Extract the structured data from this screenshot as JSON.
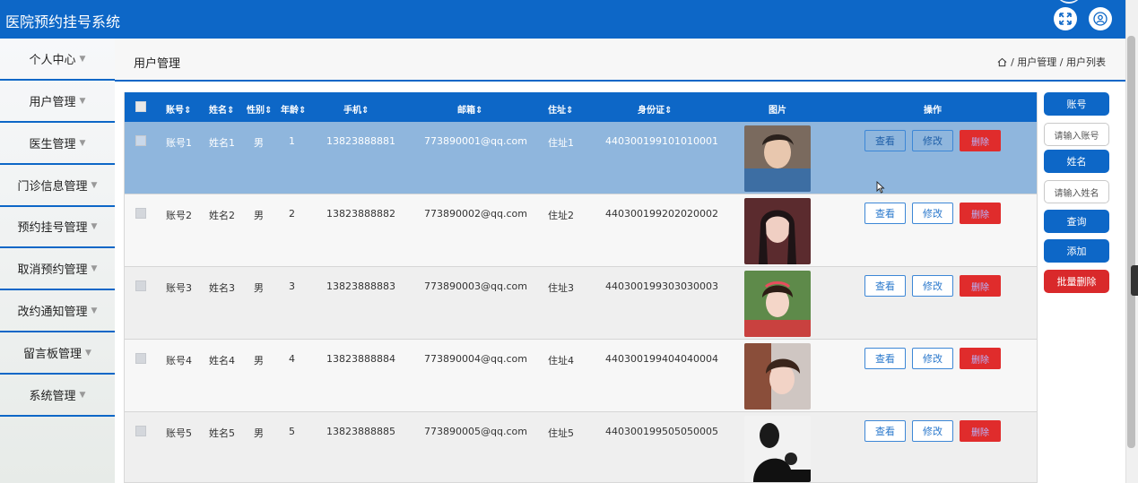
{
  "app": {
    "title": "医院预约挂号系统"
  },
  "topbar": {
    "icons": [
      "fullscreen-icon",
      "user-icon"
    ]
  },
  "sidebar": {
    "items": [
      {
        "label": "个人中心"
      },
      {
        "label": "用户管理"
      },
      {
        "label": "医生管理"
      },
      {
        "label": "门诊信息管理"
      },
      {
        "label": "预约挂号管理"
      },
      {
        "label": "取消预约管理"
      },
      {
        "label": "改约通知管理"
      },
      {
        "label": "留言板管理"
      },
      {
        "label": "系统管理"
      }
    ]
  },
  "header": {
    "page_title": "用户管理",
    "breadcrumb": "/ 用户管理 / 用户列表"
  },
  "table": {
    "columns": [
      "账号",
      "姓名",
      "性别",
      "年龄",
      "手机",
      "邮箱",
      "住址",
      "身份证",
      "图片",
      "操作"
    ],
    "rows": [
      {
        "account": "账号1",
        "name": "姓名1",
        "gender": "男",
        "age": "1",
        "phone": "13823888881",
        "email": "773890001@qq.com",
        "address": "住址1",
        "idcard": "440300199101010001"
      },
      {
        "account": "账号2",
        "name": "姓名2",
        "gender": "男",
        "age": "2",
        "phone": "13823888882",
        "email": "773890002@qq.com",
        "address": "住址2",
        "idcard": "440300199202020002"
      },
      {
        "account": "账号3",
        "name": "姓名3",
        "gender": "男",
        "age": "3",
        "phone": "13823888883",
        "email": "773890003@qq.com",
        "address": "住址3",
        "idcard": "440300199303030003"
      },
      {
        "account": "账号4",
        "name": "姓名4",
        "gender": "男",
        "age": "4",
        "phone": "13823888884",
        "email": "773890004@qq.com",
        "address": "住址4",
        "idcard": "440300199404040004"
      },
      {
        "account": "账号5",
        "name": "姓名5",
        "gender": "男",
        "age": "5",
        "phone": "13823888885",
        "email": "773890005@qq.com",
        "address": "住址5",
        "idcard": "440300199505050005"
      }
    ],
    "actions": {
      "view": "查看",
      "edit": "修改",
      "delete": "删除"
    }
  },
  "search_panel": {
    "account_label": "账号",
    "account_placeholder": "请输入账号",
    "name_label": "姓名",
    "name_placeholder": "请输入姓名",
    "query": "查询",
    "add": "添加",
    "batch_delete": "批量删除"
  }
}
